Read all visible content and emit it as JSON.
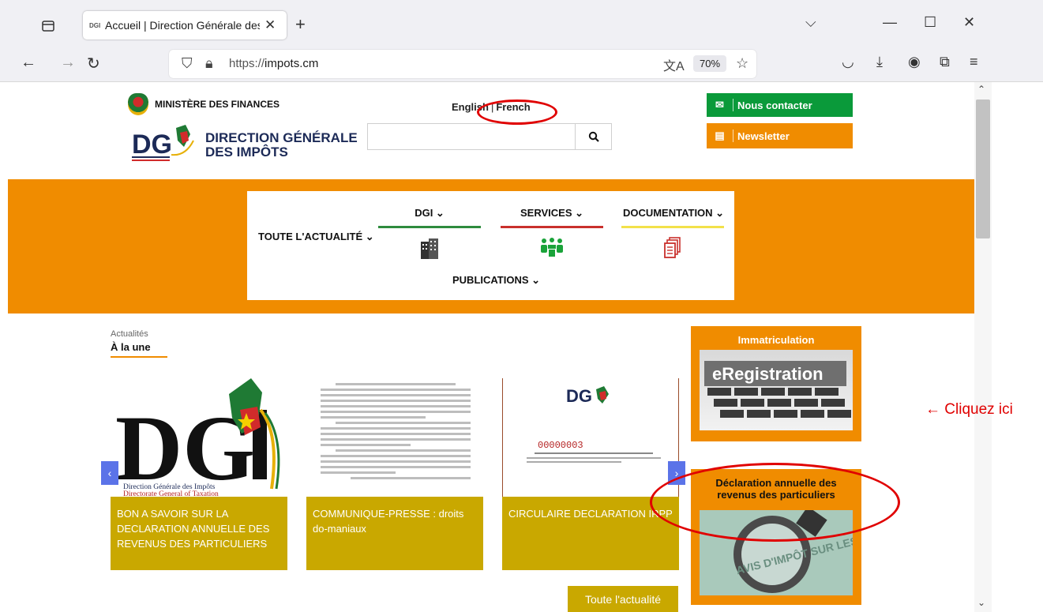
{
  "browser": {
    "tab_title": "Accueil | Direction Générale des Impôts",
    "tab_favicon": "DGI",
    "url_prefix": "https://",
    "url_domain": "impots.cm",
    "zoom": "70%",
    "icons": [
      "tab-list-icon",
      "close-icon",
      "new-tab-icon",
      "chevron-down-icon",
      "minimize-icon",
      "maximize-icon",
      "window-close-icon",
      "back-icon",
      "forward-icon",
      "reload-icon",
      "shield-icon",
      "lock-icon",
      "translate-icon",
      "bookmark-star-icon",
      "pocket-icon",
      "download-icon",
      "account-icon",
      "extensions-icon",
      "menu-icon"
    ]
  },
  "header": {
    "ministry": "MINISTÈRE DES FINANCES",
    "dgi_title_line1": "DIRECTION GÉNÉRALE",
    "dgi_title_line2": "DES IMPÔTS",
    "lang_english": "English",
    "lang_french": "French",
    "contact_label": "Nous contacter",
    "newsletter_label": "Newsletter"
  },
  "menu": {
    "actualite": "TOUTE L'ACTUALITÉ ⌄",
    "dgi": "DGI ⌄",
    "services": "SERVICES ⌄",
    "documentation": "DOCUMENTATION ⌄",
    "publications": "PUBLICATIONS ⌄"
  },
  "news": {
    "section_label": "Actualités",
    "heading": "À la une",
    "cards": [
      {
        "caption": "BON A SAVOIR SUR LA DECLARATION ANNUELLE DES REVENUS DES PARTICULIERS",
        "logo_line1": "Direction Générale des Impôts",
        "logo_line2": "Directorate General of Taxation"
      },
      {
        "caption": "COMMUNIQUE-PRESSE : droits do-maniaux"
      },
      {
        "caption": "CIRCULAIRE DECLARATION IRPP",
        "doc_number": "00000003"
      }
    ],
    "all_news_button": "Toute l'actualité"
  },
  "sidebar": {
    "immatriculation_title": "Immatriculation",
    "eregistration_text": "eRegistration",
    "declaration_title": "Déclaration annuelle des revenus des particuliers",
    "avis_text": "AVIS D'IMPÔT SUR LES REVENUS"
  },
  "annotation": {
    "cliquez": "← Cliquez ici",
    "color": "#e00000"
  },
  "colors": {
    "orange": "#f08c00",
    "green": "#0a9a3a",
    "gold": "#c9a800"
  }
}
